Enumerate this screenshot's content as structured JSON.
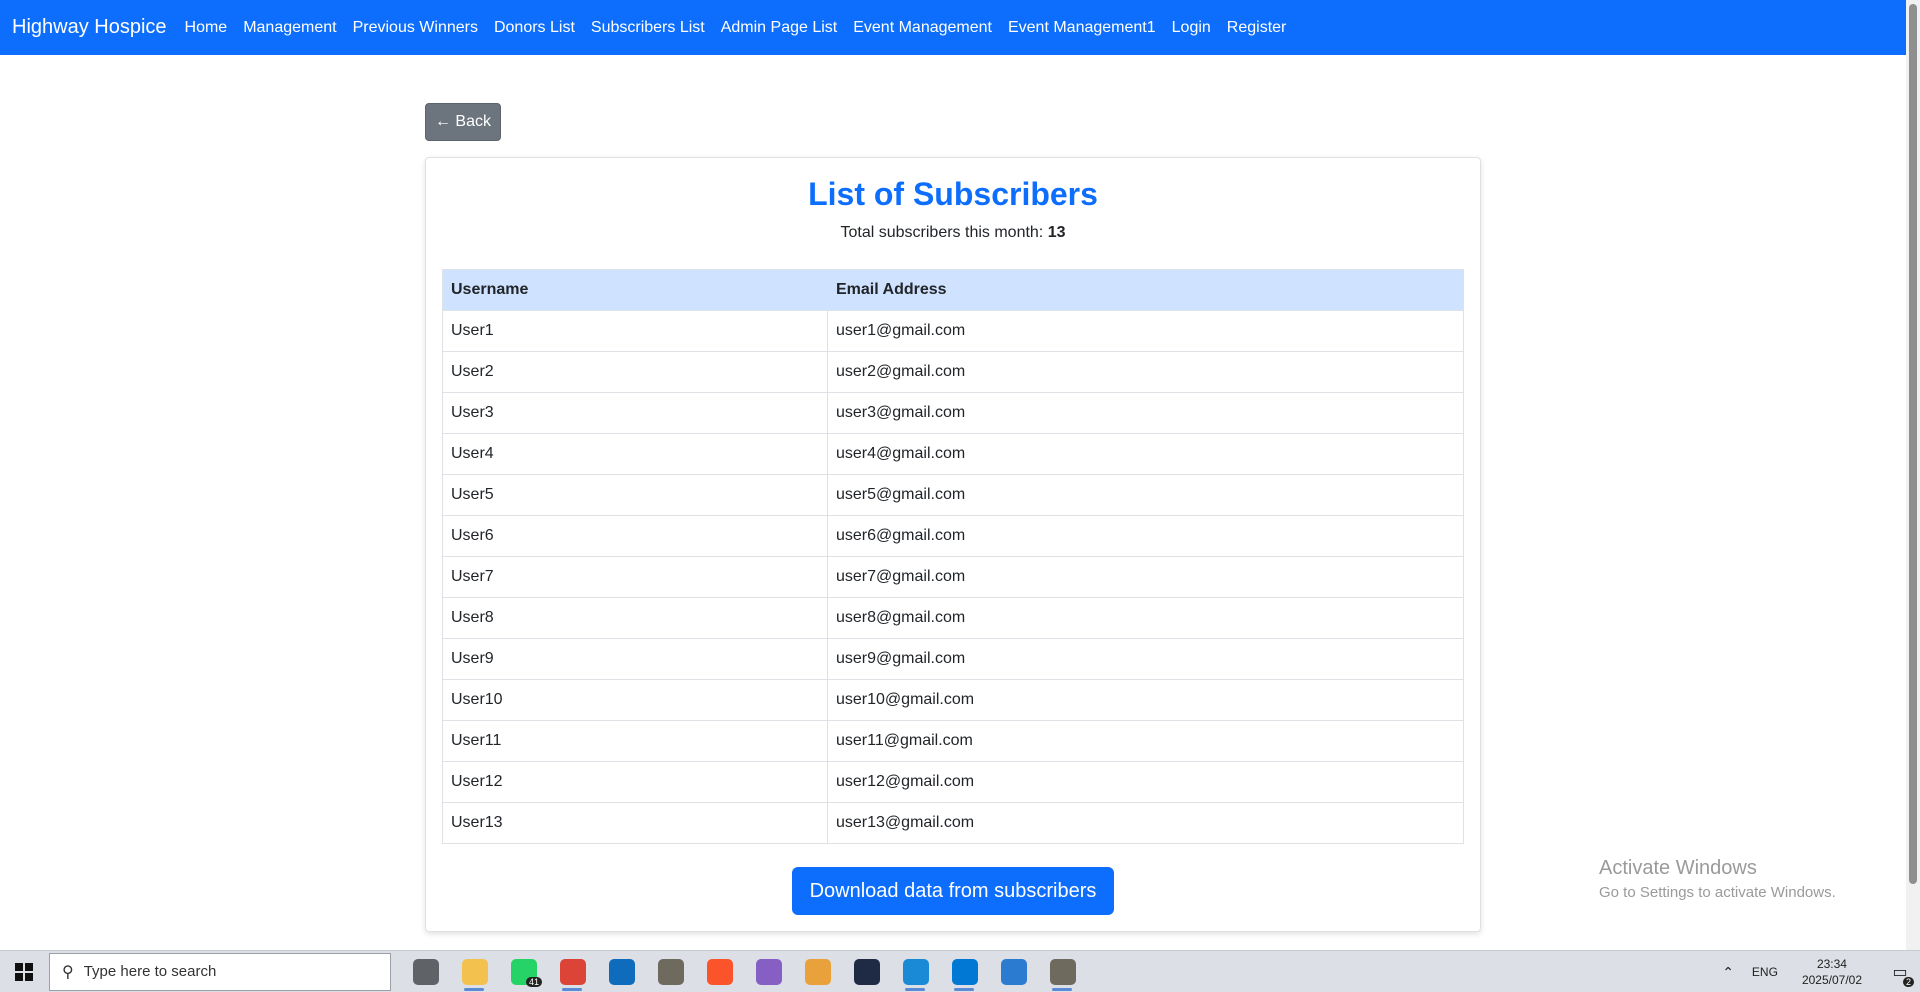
{
  "navbar": {
    "brand": "Highway Hospice",
    "links": [
      "Home",
      "Management",
      "Previous Winners",
      "Donors List",
      "Subscribers List",
      "Admin Page List",
      "Event Management",
      "Event Management1",
      "Login",
      "Register"
    ],
    "color": "#0d6efd"
  },
  "back_button": "← Back",
  "card": {
    "title": "List of Subscribers",
    "summary_label": "Total subscribers this month:",
    "summary_count": "13",
    "table": {
      "headers": [
        "Username",
        "Email Address"
      ],
      "rows": [
        [
          "User1",
          "user1@gmail.com"
        ],
        [
          "User2",
          "user2@gmail.com"
        ],
        [
          "User3",
          "user3@gmail.com"
        ],
        [
          "User4",
          "user4@gmail.com"
        ],
        [
          "User5",
          "user5@gmail.com"
        ],
        [
          "User6",
          "user6@gmail.com"
        ],
        [
          "User7",
          "user7@gmail.com"
        ],
        [
          "User8",
          "user8@gmail.com"
        ],
        [
          "User9",
          "user9@gmail.com"
        ],
        [
          "User10",
          "user10@gmail.com"
        ],
        [
          "User11",
          "user11@gmail.com"
        ],
        [
          "User12",
          "user12@gmail.com"
        ],
        [
          "User13",
          "user13@gmail.com"
        ]
      ]
    },
    "download_button": "Download data from subscribers"
  },
  "watermark": {
    "line1": "Activate Windows",
    "line2": "Go to Settings to activate Windows."
  },
  "taskbar": {
    "search_placeholder": "Type here to search",
    "apps": [
      {
        "name": "task-view-icon",
        "color": "#5f6368"
      },
      {
        "name": "file-explorer-icon",
        "color": "#f2c14e"
      },
      {
        "name": "whatsapp-icon",
        "color": "#25d366",
        "badge": "41"
      },
      {
        "name": "chrome-icon",
        "color": "#db4437"
      },
      {
        "name": "outlook-icon",
        "color": "#0f6cbd"
      },
      {
        "name": "gimp-icon",
        "color": "#6e6a5e"
      },
      {
        "name": "brave-icon",
        "color": "#fb542b"
      },
      {
        "name": "visual-studio-icon",
        "color": "#865fc5"
      },
      {
        "name": "copilot-icon",
        "color": "#e9a23b"
      },
      {
        "name": "dev-tool-icon",
        "color": "#1f2a44"
      },
      {
        "name": "edge-icon",
        "color": "#1a8ad6"
      },
      {
        "name": "vscode-icon",
        "color": "#0078d4"
      },
      {
        "name": "photos-icon",
        "color": "#2b7bd1"
      },
      {
        "name": "gimp-2-icon",
        "color": "#6e6a5e"
      }
    ],
    "active_apps": [
      1,
      3,
      10,
      11,
      13
    ],
    "language": "ENG",
    "time": "23:34",
    "date": "2025/07/02",
    "notification_count": "2"
  }
}
